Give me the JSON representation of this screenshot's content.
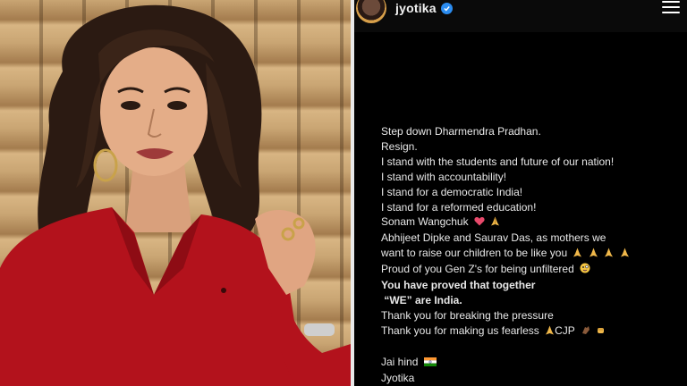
{
  "profile": {
    "username": "jyotika",
    "verified": true
  },
  "post": {
    "lines": [
      {
        "text": "Step down Dharmendra Pradhan.",
        "bold": false,
        "emoji": ""
      },
      {
        "text": "Resign.",
        "bold": false,
        "emoji": ""
      },
      {
        "text": "I stand with the students and future of our nation!",
        "bold": false,
        "emoji": ""
      },
      {
        "text": "I stand with accountability!",
        "bold": false,
        "emoji": ""
      },
      {
        "text": "I stand for a democratic India!",
        "bold": false,
        "emoji": ""
      },
      {
        "text": "I stand for a reformed education!",
        "bold": false,
        "emoji": ""
      },
      {
        "text": "Sonam Wangchuk",
        "bold": false,
        "emoji": "heart-folded-hands"
      },
      {
        "text": "Abhijeet Dipke and Saurav Das, as mothers we",
        "bold": false,
        "emoji": ""
      },
      {
        "text": "want to raise our children to be like you",
        "bold": false,
        "emoji": "folded-hands-x4"
      },
      {
        "text": "Proud of you Gen Z's for being unfiltered",
        "bold": false,
        "emoji": "zany-face"
      },
      {
        "text": "You have proved that together",
        "bold": true,
        "emoji": ""
      },
      {
        "text": " “WE” are India.",
        "bold": true,
        "emoji": ""
      },
      {
        "text": "Thank you for breaking the pressure",
        "bold": false,
        "emoji": ""
      },
      {
        "text": "Thank you for making us fearless",
        "bold": false,
        "emoji": "folded-hands-cjp"
      },
      {
        "text": "",
        "bold": false,
        "emoji": ""
      },
      {
        "text": "Jai hind",
        "bold": false,
        "emoji": "india-flag"
      },
      {
        "text": "Jyotika",
        "bold": false,
        "emoji": ""
      }
    ],
    "emoji_text": {
      "folded-hands-cjp": "CJP"
    }
  },
  "icons": {
    "verified": "verified-badge-icon",
    "menu": "hamburger-menu-icon"
  },
  "colors": {
    "background": "#000000",
    "text": "#e8e8e8",
    "verified": "#2b8cf0",
    "shirt": "#b3121c"
  }
}
